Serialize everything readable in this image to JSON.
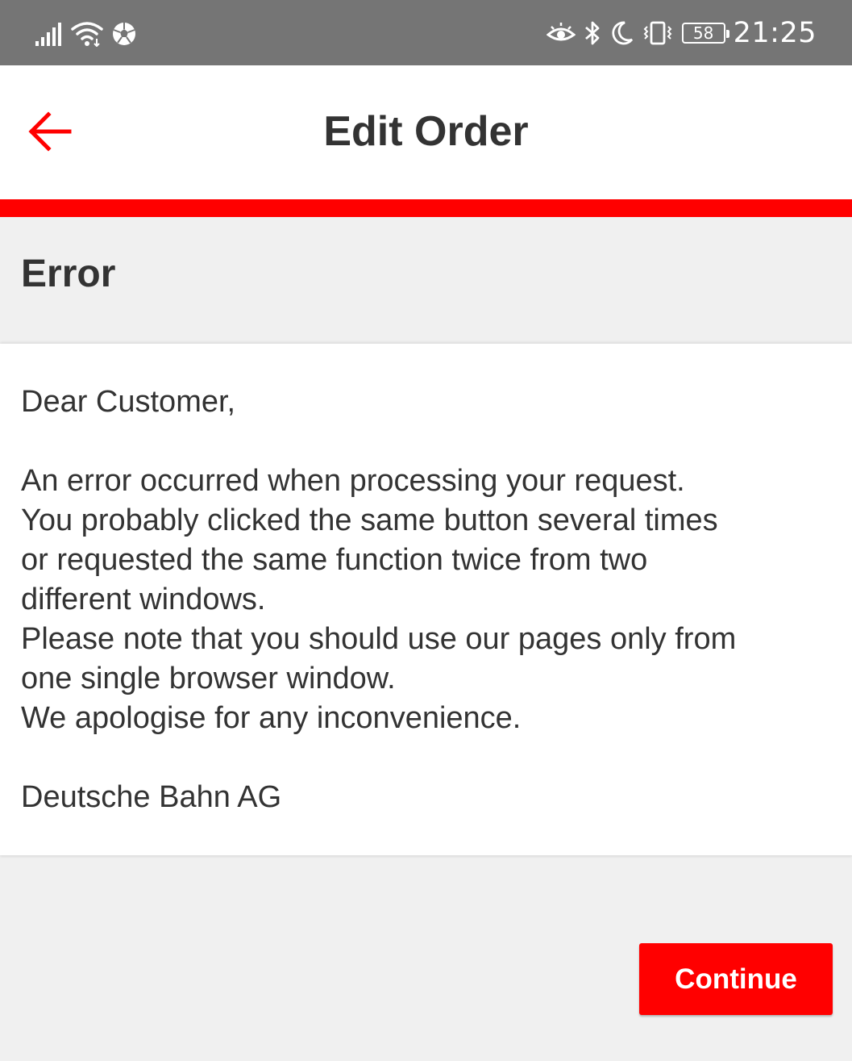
{
  "status_bar": {
    "time": "21:25",
    "battery_level": "58",
    "icons_left": [
      "signal-icon",
      "wifi-icon",
      "soccer-ball-icon"
    ],
    "icons_right": [
      "eye-icon",
      "bluetooth-icon",
      "moon-icon",
      "vibrate-icon",
      "battery-icon"
    ]
  },
  "app_bar": {
    "title": "Edit Order",
    "back_icon": "arrow-left-icon"
  },
  "colors": {
    "accent": "#ff0000",
    "status_bar_bg": "#757575",
    "text": "#333333",
    "page_bg": "#f0f0f0"
  },
  "error": {
    "heading": "Error",
    "greeting": "Dear Customer,",
    "body_lines": [
      "An error occurred when processing your request.",
      "You probably clicked the same button several times",
      "or requested the same function twice from two",
      "different windows.",
      "Please note that you should use our pages only from",
      "one single browser window.",
      "We apologise for any inconvenience."
    ],
    "signature": "Deutsche Bahn AG"
  },
  "actions": {
    "continue_label": "Continue"
  }
}
